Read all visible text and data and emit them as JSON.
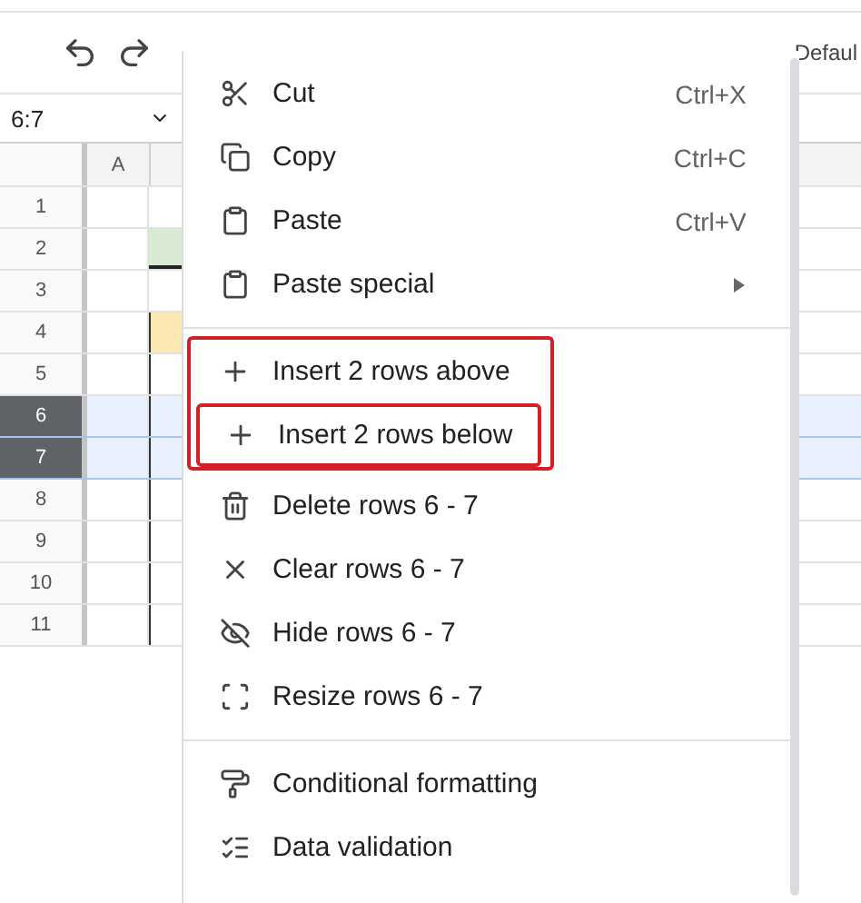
{
  "toolbar": {
    "font_name": "Defaul"
  },
  "name_box": {
    "value": "6:7"
  },
  "columns": [
    {
      "label": "A"
    }
  ],
  "rows": [
    {
      "label": "1",
      "selected": false
    },
    {
      "label": "2",
      "selected": false
    },
    {
      "label": "3",
      "selected": false
    },
    {
      "label": "4",
      "selected": false
    },
    {
      "label": "5",
      "selected": false
    },
    {
      "label": "6",
      "selected": true
    },
    {
      "label": "7",
      "selected": true
    },
    {
      "label": "8",
      "selected": false
    },
    {
      "label": "9",
      "selected": false
    },
    {
      "label": "10",
      "selected": false
    },
    {
      "label": "11",
      "selected": false
    }
  ],
  "context_menu": {
    "sections": [
      {
        "groups": [
          {
            "outlined": false,
            "items": [
              {
                "label": "Cut",
                "shortcut": "Ctrl+X",
                "submenu": false,
                "outlined": false
              },
              {
                "label": "Copy",
                "shortcut": "Ctrl+C",
                "submenu": false,
                "outlined": false
              },
              {
                "label": "Paste",
                "shortcut": "Ctrl+V",
                "submenu": false,
                "outlined": false
              },
              {
                "label": "Paste special",
                "submenu": true,
                "outlined": false
              }
            ]
          }
        ]
      },
      {
        "groups": [
          {
            "outlined": true,
            "items": [
              {
                "label": "Insert 2 rows above",
                "submenu": false,
                "outlined": false
              },
              {
                "label": "Insert 2 rows below",
                "submenu": false,
                "outlined": true
              }
            ]
          },
          {
            "outlined": false,
            "items": [
              {
                "label": "Delete rows 6 - 7",
                "submenu": false,
                "outlined": false
              },
              {
                "label": "Clear rows 6 - 7",
                "submenu": false,
                "outlined": false
              },
              {
                "label": "Hide rows 6 - 7",
                "submenu": false,
                "outlined": false
              },
              {
                "label": "Resize rows 6 - 7",
                "submenu": false,
                "outlined": false
              }
            ]
          }
        ]
      },
      {
        "groups": [
          {
            "outlined": false,
            "items": [
              {
                "label": "Conditional formatting",
                "submenu": false,
                "outlined": false
              },
              {
                "label": "Data validation",
                "submenu": false,
                "outlined": false
              }
            ]
          }
        ]
      }
    ]
  }
}
